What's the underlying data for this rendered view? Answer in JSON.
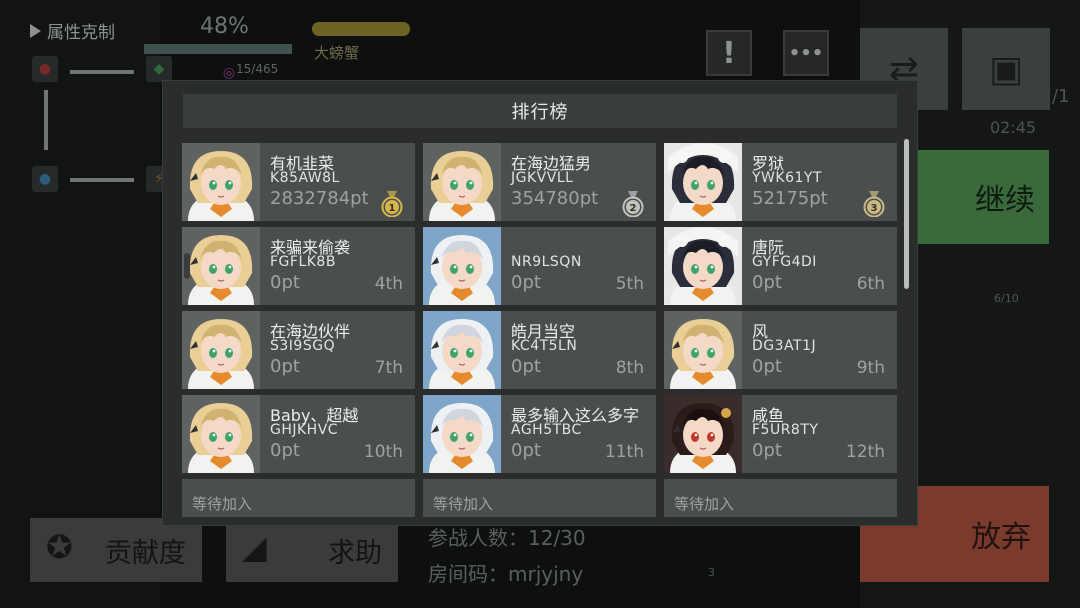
{
  "hud": {
    "attribute_label": "属性克制",
    "percent": "48%",
    "boss_label": "大螃蟹",
    "stat_count": "15/465",
    "continue_label": "继续",
    "abandon_label": "放弃",
    "timer": "02:45",
    "page_indicator": "/1",
    "round_count": "6/10",
    "round_count_2": "3",
    "contribution_label": "贡献度",
    "help_label": "求助",
    "participants": "参战人数：12/30",
    "room_code": "房间码：mrjyjny",
    "colors": {
      "continue": "#3a6a3c",
      "abandon": "#7a3a2c",
      "gold": "#d4b84a"
    }
  },
  "leaderboard": {
    "title": "排行榜",
    "entries": [
      {
        "name": "有机韭菜",
        "id": "K85AW8L",
        "points": "2832784pt",
        "rank": "1",
        "avatar": "blonde-girl"
      },
      {
        "name": "在海边猛男",
        "id": "JGKVVLL",
        "points": "354780pt",
        "rank": "2",
        "avatar": "blonde-girl"
      },
      {
        "name": "罗狱",
        "id": "YWK61YT",
        "points": "52175pt",
        "rank": "3",
        "avatar": "dark-hood-girl"
      },
      {
        "name": "来骗来偷袭",
        "id": "FGFLK8B",
        "points": "0pt",
        "rank": "4th",
        "avatar": "blonde-headset-girl"
      },
      {
        "name": "",
        "id": "NR9LSQN",
        "points": "0pt",
        "rank": "5th",
        "avatar": "white-hair-girl"
      },
      {
        "name": "唐阮",
        "id": "GYFG4DI",
        "points": "0pt",
        "rank": "6th",
        "avatar": "dark-hood-girl"
      },
      {
        "name": "在海边伙伴",
        "id": "S3I9SGQ",
        "points": "0pt",
        "rank": "7th",
        "avatar": "blonde-girl"
      },
      {
        "name": "皓月当空",
        "id": "KC4T5LN",
        "points": "0pt",
        "rank": "8th",
        "avatar": "white-hair-girl"
      },
      {
        "name": "风",
        "id": "DG3AT1J",
        "points": "0pt",
        "rank": "9th",
        "avatar": "blonde-girl"
      },
      {
        "name": "Baby、超越",
        "id": "GHJKHVC",
        "points": "0pt",
        "rank": "10th",
        "avatar": "blonde-girl"
      },
      {
        "name": "最多输入这么多字",
        "id": "AGH5TBC",
        "points": "0pt",
        "rank": "11th",
        "avatar": "white-hair-girl"
      },
      {
        "name": "咸鱼",
        "id": "F5UR8TY",
        "points": "0pt",
        "rank": "12th",
        "avatar": "dark-hair-girl"
      }
    ],
    "waiting_label": "等待加入",
    "medal_colors": [
      "#d4b64a",
      "#bfc3c2",
      "#c9b986"
    ]
  }
}
